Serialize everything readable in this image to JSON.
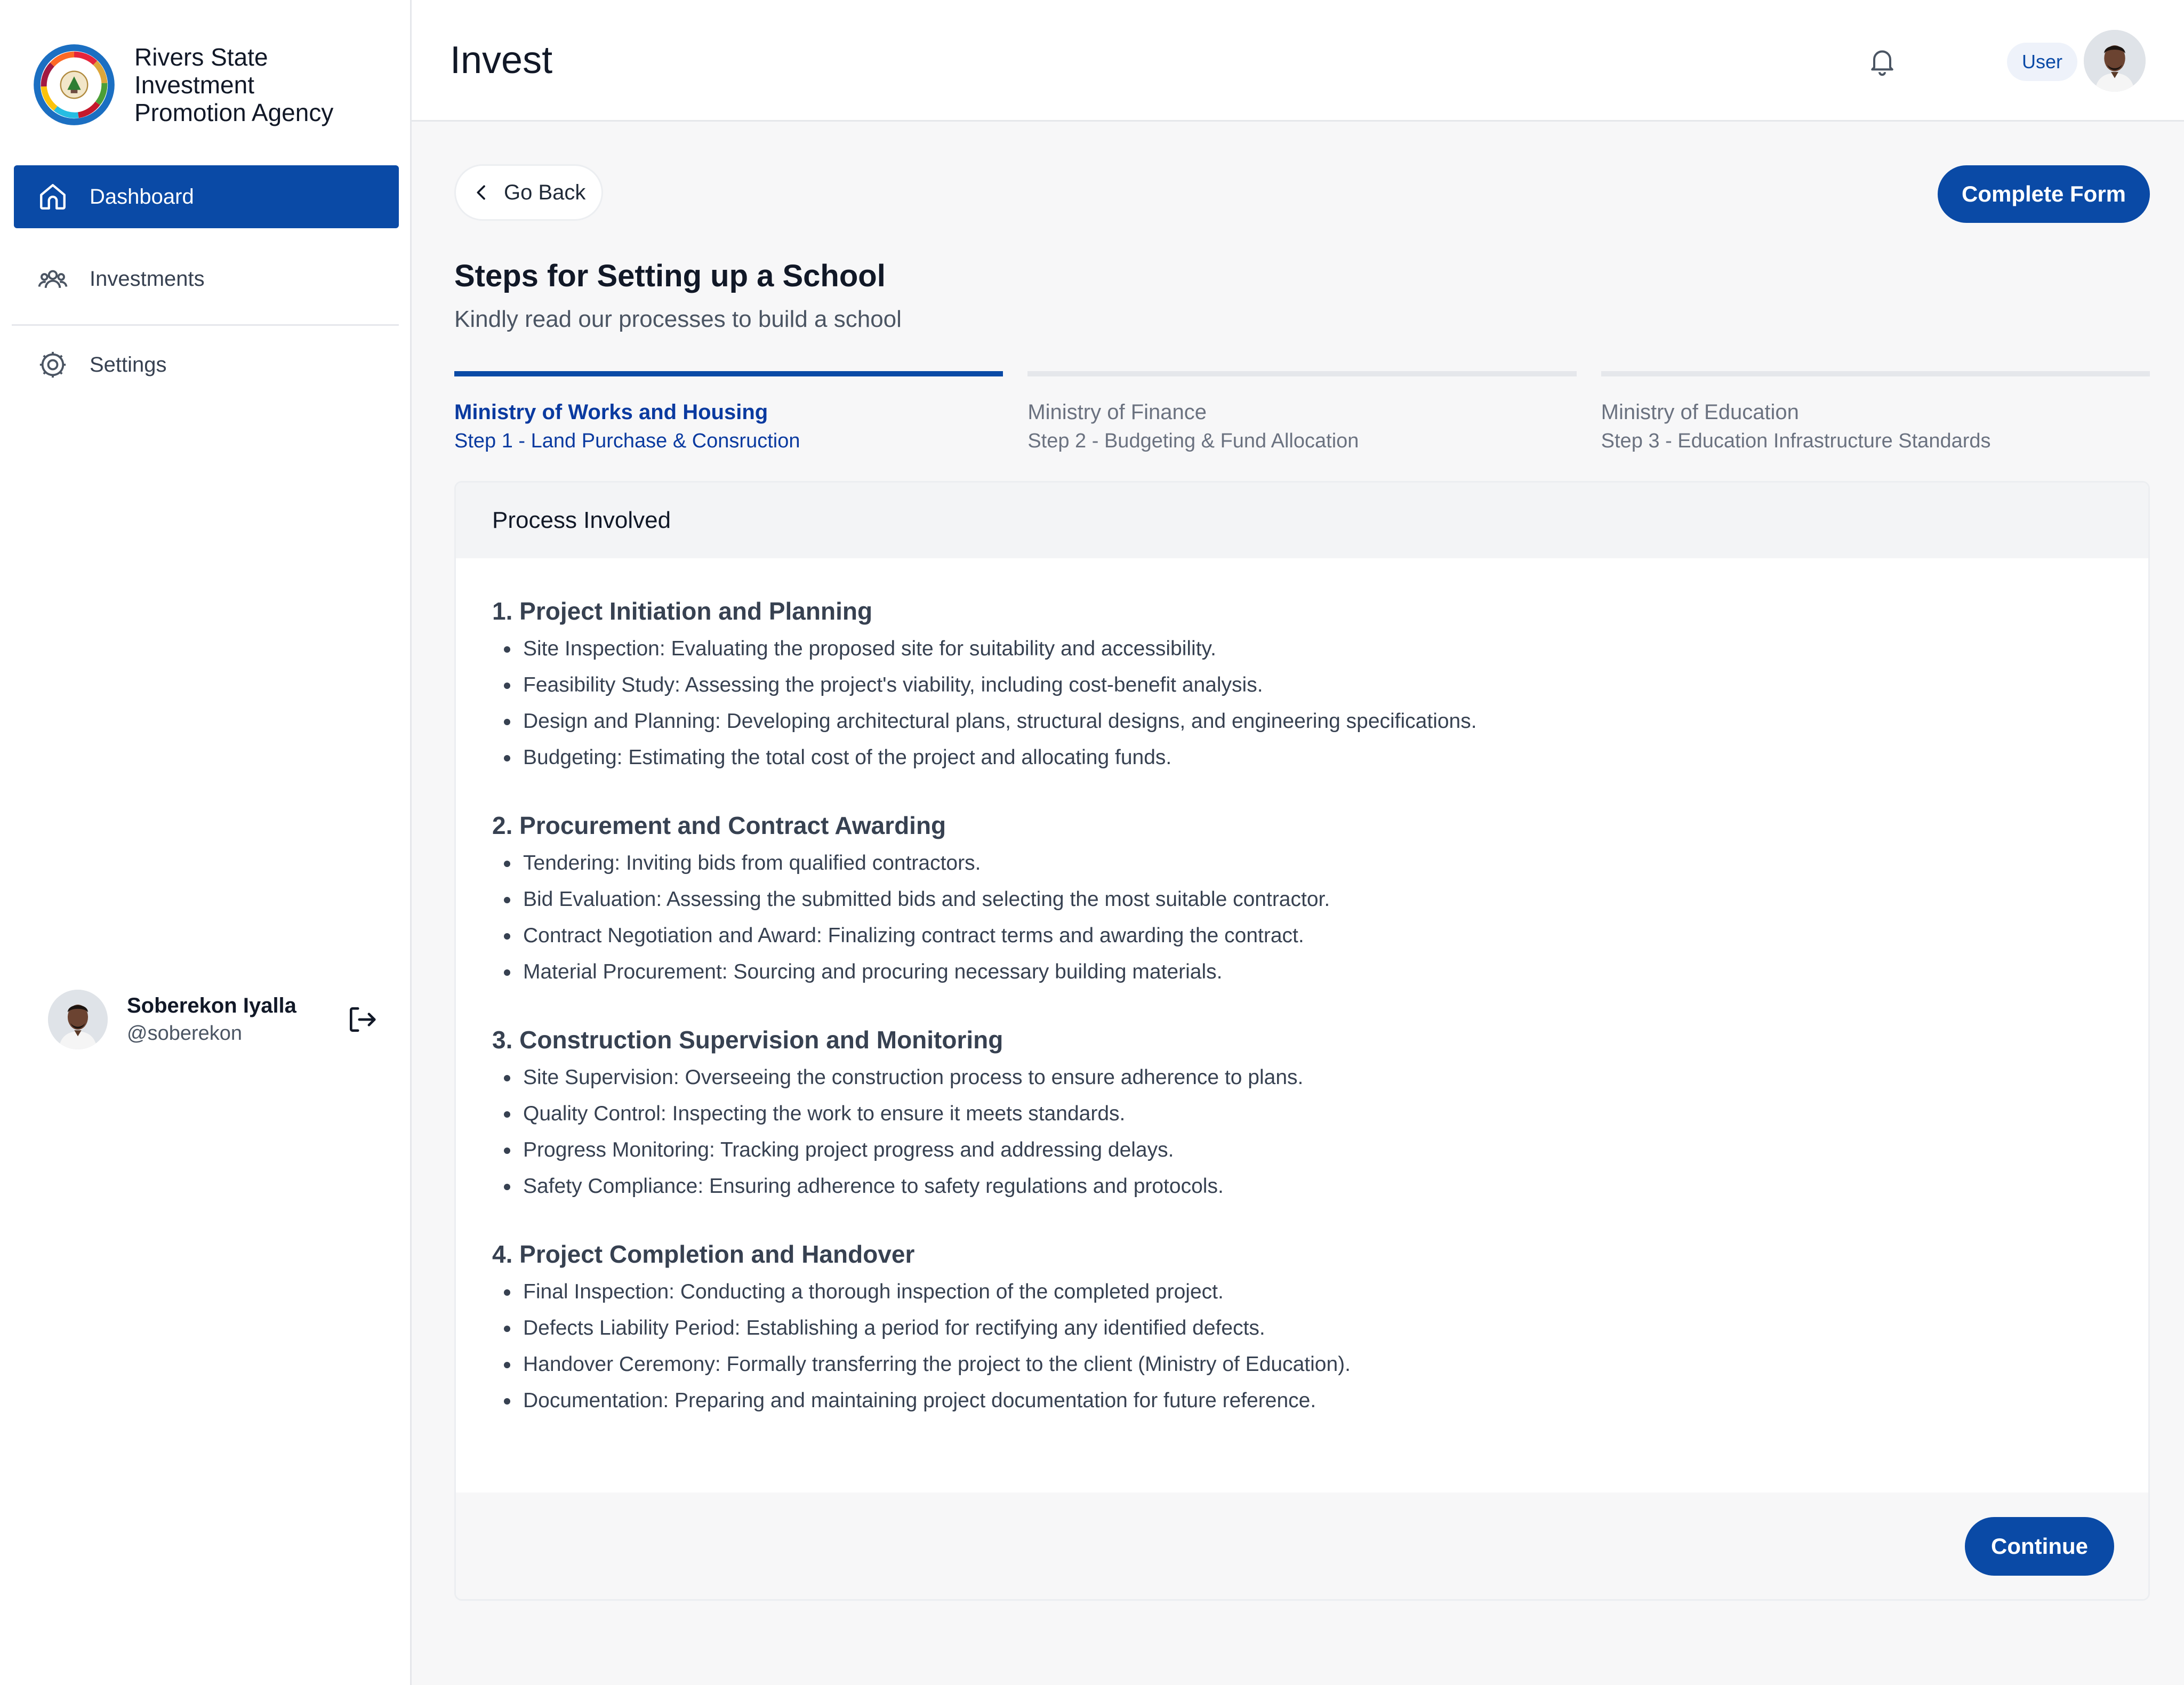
{
  "brand": {
    "name_line1": "Rivers State",
    "name_line2": "Investment",
    "name_line3": "Promotion Agency",
    "logo_icon": "agency-seal-logo"
  },
  "sidebar": {
    "items": [
      {
        "label": "Dashboard",
        "icon": "home-icon",
        "active": true
      },
      {
        "label": "Investments",
        "icon": "users-icon",
        "active": false
      },
      {
        "label": "Settings",
        "icon": "gear-icon",
        "active": false
      }
    ],
    "profile": {
      "name": "Soberekon Iyalla",
      "handle": "@soberekon"
    }
  },
  "topbar": {
    "title": "Invest",
    "role_badge": "User"
  },
  "main": {
    "go_back_label": "Go Back",
    "complete_form_label": "Complete Form",
    "heading": "Steps for Setting up a School",
    "subheading": "Kindly read our processes to build a school",
    "steps": [
      {
        "title": "Ministry of Works and Housing",
        "subtitle": "Step 1 - Land Purchase & Consruction",
        "active": true
      },
      {
        "title": "Ministry of Finance",
        "subtitle": "Step 2 - Budgeting & Fund Allocation",
        "active": false
      },
      {
        "title": "Ministry of Education",
        "subtitle": "Step 3 - Education Infrastructure Standards",
        "active": false
      }
    ],
    "card": {
      "header": "Process Involved",
      "sections": [
        {
          "title": "1. Project Initiation and Planning",
          "items": [
            "Site Inspection: Evaluating the proposed site for suitability and accessibility.",
            "Feasibility Study: Assessing the project's viability, including cost-benefit analysis.",
            "Design and Planning: Developing architectural plans, structural designs, and engineering specifications.",
            "Budgeting: Estimating the total cost of the project and allocating funds."
          ]
        },
        {
          "title": "2. Procurement and Contract Awarding",
          "items": [
            "Tendering: Inviting bids from qualified contractors.",
            "Bid Evaluation: Assessing the submitted bids and selecting the most suitable contractor.",
            "Contract Negotiation and Award: Finalizing contract terms and awarding the contract.",
            "Material Procurement: Sourcing and procuring necessary building materials."
          ]
        },
        {
          "title": "3. Construction Supervision and Monitoring",
          "items": [
            "Site Supervision: Overseeing the construction process to ensure adherence to plans.",
            "Quality Control: Inspecting the work to ensure it meets standards.",
            "Progress Monitoring: Tracking project progress and addressing delays.",
            "Safety Compliance: Ensuring adherence to safety regulations and protocols."
          ]
        },
        {
          "title": "4. Project Completion and Handover",
          "items": [
            "Final Inspection: Conducting a thorough inspection of the completed project.",
            "Defects Liability Period: Establishing a period for rectifying any identified defects.",
            "Handover Ceremony: Formally transferring the project to the client (Ministry of Education).",
            "Documentation: Preparing and maintaining project documentation for future reference."
          ]
        }
      ],
      "continue_label": "Continue"
    }
  },
  "colors": {
    "primary": "#0a4aa6",
    "active_step_text": "#0a3aa0",
    "background": "#f7f7f8"
  }
}
